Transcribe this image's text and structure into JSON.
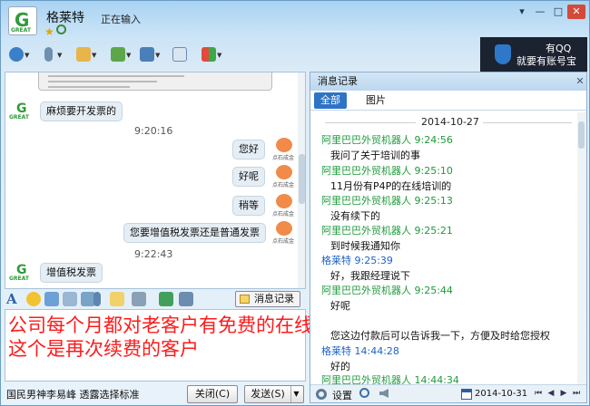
{
  "window": {
    "contact_name": "格莱特",
    "typing_status": "正在输入",
    "logo_text": "GREAT"
  },
  "ad": {
    "line1": "有QQ",
    "line2": "就要有账号宝"
  },
  "chat": {
    "messages": [
      {
        "side": "left",
        "text": "麻烦要开发票的"
      },
      {
        "side": "time",
        "text": "9:20:16"
      },
      {
        "side": "right",
        "text": "您好"
      },
      {
        "side": "right",
        "text": "好呢"
      },
      {
        "side": "right",
        "text": "稍等"
      },
      {
        "side": "right",
        "text": "您要增值税发票还是普通发票"
      },
      {
        "side": "time",
        "text": "9:22:43"
      },
      {
        "side": "left",
        "text": "增值税发票"
      }
    ],
    "self_avatar_label": "点石成金"
  },
  "input_toolbar": {
    "history_button": "消息记录"
  },
  "overlay": {
    "line1": "公司每个月都对老客户有免费的在线培训",
    "line2": "这个是再次续费的客户"
  },
  "status_text": "国民男神李易峰 透露选择标准",
  "buttons": {
    "close": "关闭(C)",
    "send": "发送(S)"
  },
  "history": {
    "title": "消息记录",
    "tabs": [
      "全部",
      "图片"
    ],
    "date": "2014-10-27",
    "entries": [
      {
        "role": "other",
        "sender": "阿里巴巴外贸机器人 9:24:56",
        "text": "我问了关于培训的事"
      },
      {
        "role": "other",
        "sender": "阿里巴巴外贸机器人 9:25:10",
        "text": "11月份有P4P的在线培训的"
      },
      {
        "role": "other",
        "sender": "阿里巴巴外贸机器人 9:25:13",
        "text": "没有续下的"
      },
      {
        "role": "other",
        "sender": "阿里巴巴外贸机器人 9:25:21",
        "text": "到时候我通知你"
      },
      {
        "role": "self",
        "sender": "格莱特 9:25:39",
        "text": "好，我跟经理说下"
      },
      {
        "role": "other",
        "sender": "阿里巴巴外贸机器人 9:25:44",
        "text": "好呢"
      },
      {
        "role": "other",
        "sender": "",
        "text": "您这边付款后可以告诉我一下，方便及时给您授权"
      },
      {
        "role": "self",
        "sender": "格莱特 14:44:28",
        "text": "好的"
      },
      {
        "role": "other",
        "sender": "阿里巴巴外贸机器人 14:44:34",
        "text": ""
      }
    ],
    "settings_label": "设置",
    "calendar_date": "2014-10-31"
  }
}
